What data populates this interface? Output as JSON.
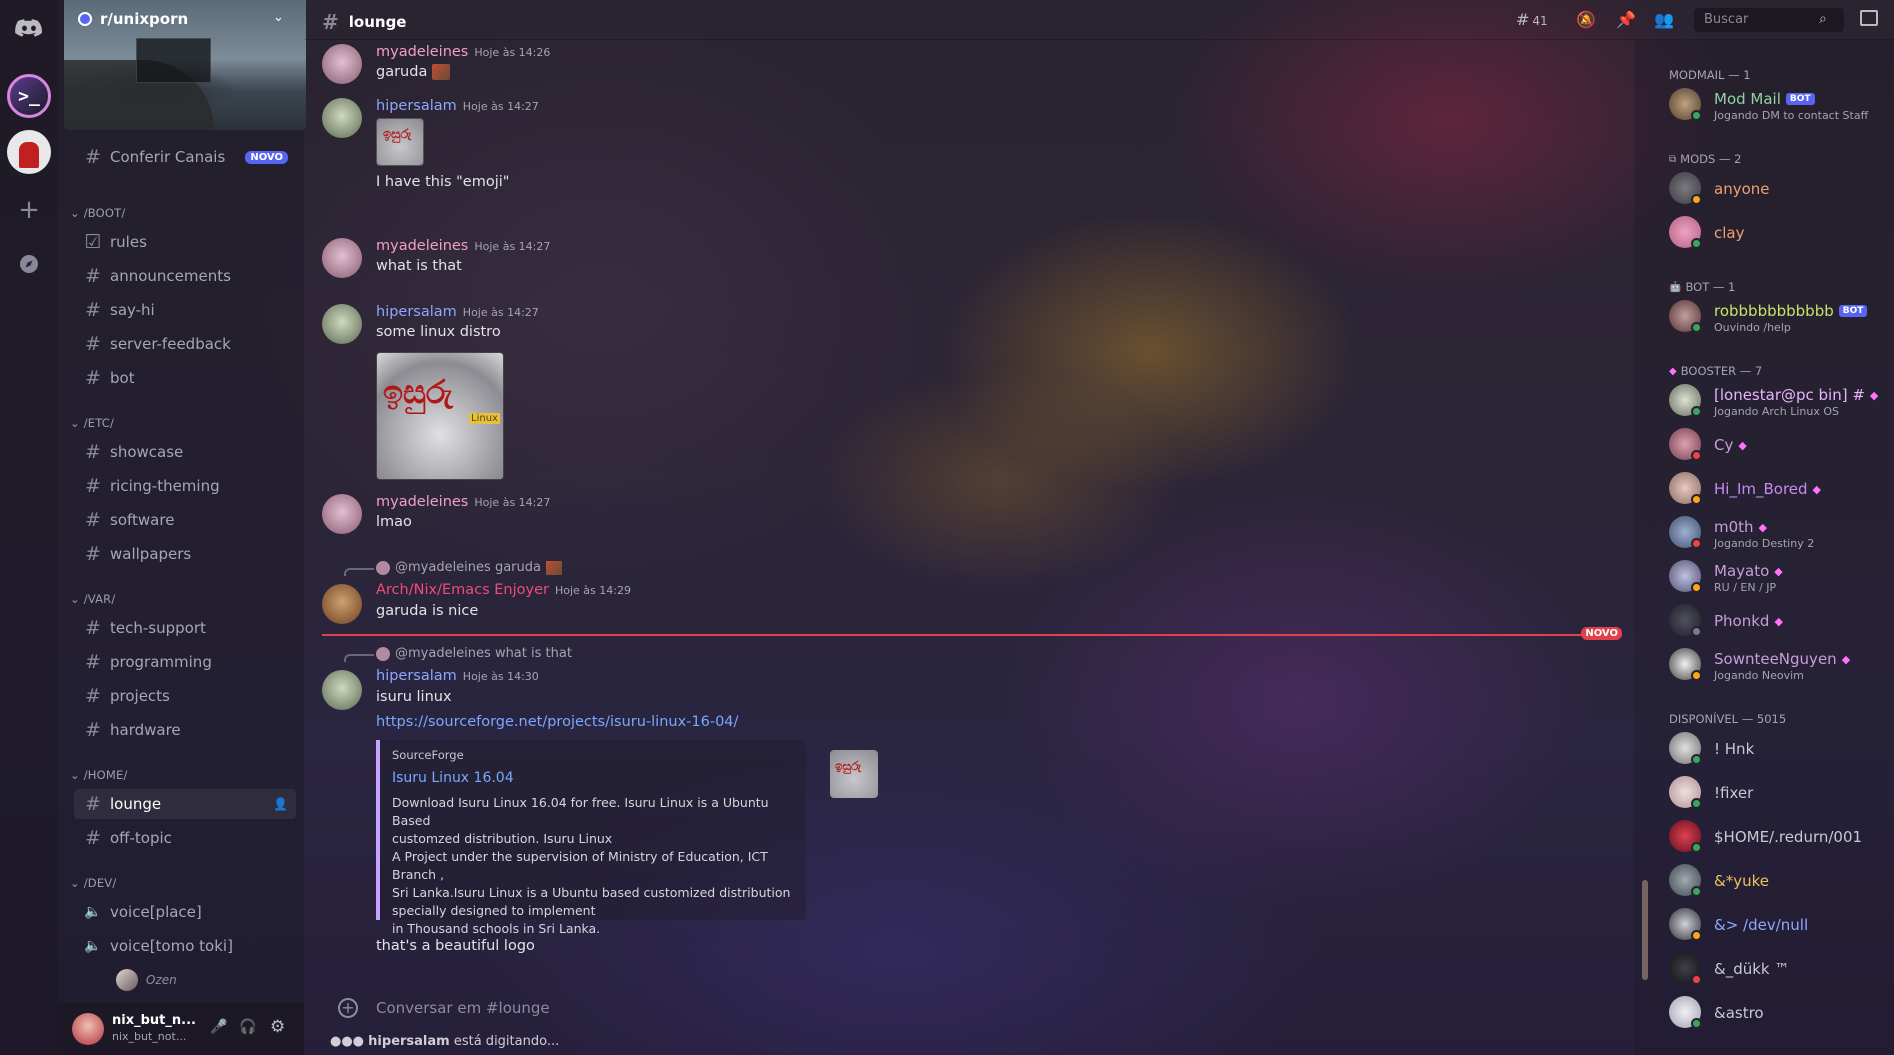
{
  "server": {
    "name": "r/unixporn",
    "browse_label": "Conferir Canais",
    "browse_badge": "NOVO"
  },
  "categories": {
    "boot": "/BOOT/",
    "etc": "/ETC/",
    "var": "/VAR/",
    "home": "/HOME/",
    "dev": "/DEV/"
  },
  "channels": {
    "rules": "rules",
    "announcements": "announcements",
    "say_hi": "say-hi",
    "server_feedback": "server-feedback",
    "bot": "bot",
    "showcase": "showcase",
    "ricing_theming": "ricing-theming",
    "software": "software",
    "wallpapers": "wallpapers",
    "tech_support": "tech-support",
    "programming": "programming",
    "projects": "projects",
    "hardware": "hardware",
    "lounge": "lounge",
    "off_topic": "off-topic",
    "voice_place": "voice[place]",
    "voice_tomo": "voice[tomo toki]",
    "voice_user": "Ozen"
  },
  "user": {
    "name": "nix_but_n...",
    "tag": "nix_but_not..."
  },
  "topbar": {
    "channel": "lounge",
    "threads_count": "41",
    "search_placeholder": "Buscar"
  },
  "messages": [
    {
      "author": "myadeleines",
      "time": "Hoje às 14:26",
      "text": "garuda"
    },
    {
      "author": "hipersalam",
      "time": "Hoje às 14:27",
      "text": "I have this \"emoji\""
    },
    {
      "author": "myadeleines",
      "time": "Hoje às 14:27",
      "text": "what is that"
    },
    {
      "author": "hipersalam",
      "time": "Hoje às 14:27",
      "text": "some linux distro"
    },
    {
      "author": "myadeleines",
      "time": "Hoje às 14:27",
      "text": "lmao"
    },
    {
      "reply": "@myadeleines garuda",
      "author": "Arch/Nix/Emacs Enjoyer",
      "time": "Hoje às 14:29",
      "text": "garuda is nice"
    },
    {
      "reply": "@myadeleines what is that",
      "author": "hipersalam",
      "time": "Hoje às 14:30",
      "text": "isuru linux",
      "link": "https://sourceforge.net/projects/isuru-linux-16-04/",
      "followup": "that's a beautiful logo"
    }
  ],
  "embed": {
    "provider": "SourceForge",
    "title": "Isuru Linux 16.04",
    "desc": [
      "Download Isuru Linux 16.04 for free. Isuru Linux is a Ubuntu Based",
      "customzed distribution. Isuru Linux",
      "A Project under the supervision of Ministry of Education, ICT Branch ,",
      "Sri Lanka.Isuru Linux is a Ubuntu based customized distribution",
      "specially designed to implement",
      "in Thousand schools in Sri Lanka."
    ]
  },
  "new_marker": "NOVO",
  "composer": {
    "placeholder": "Conversar em #lounge"
  },
  "typing": {
    "user": "hipersalam",
    "text": "está digitando..."
  },
  "member_groups": {
    "modmail": "MODMAIL — 1",
    "mods": "MODS — 2",
    "bot": "BOT — 1",
    "booster": "BOOSTER — 7",
    "online": "DISPONÍVEL — 5015"
  },
  "members": [
    {
      "name": "Mod Mail",
      "status": "Jogando DM to contact Staff",
      "badge": "BOT",
      "color": "#8fd3a0"
    },
    {
      "name": "anyone",
      "color": "#f0a070"
    },
    {
      "name": "clay",
      "color": "#f0a070"
    },
    {
      "name": "robbbbbbbbbbb",
      "status": "Ouvindo /help",
      "badge": "BOT",
      "color": "#c8e36a"
    },
    {
      "name": "[lonestar@pc bin] #",
      "status": "Jogando Arch Linux OS",
      "color": "#e8b4ff"
    },
    {
      "name": "Cy",
      "color": "#c99dd8"
    },
    {
      "name": "Hi_Im_Bored",
      "color": "#c58cf0"
    },
    {
      "name": "m0th",
      "status": "Jogando Destiny 2",
      "color": "#c99dd8"
    },
    {
      "name": "Mayato",
      "status": "RU / EN / JP",
      "color": "#c99dd8"
    },
    {
      "name": "Phonkd",
      "color": "#c99dd8"
    },
    {
      "name": "SownteeNguyen",
      "status": "Jogando Neovim",
      "color": "#c99dd8"
    },
    {
      "name": "! Hnk",
      "color": "#c9c7d2"
    },
    {
      "name": "!fixer",
      "color": "#c9c7d2"
    },
    {
      "name": "$HOME/.redurn/001",
      "color": "#c9c7d2"
    },
    {
      "name": "&*yuke",
      "color": "#f0c060"
    },
    {
      "name": "&> /dev/null",
      "color": "#8fa8ff"
    },
    {
      "name": "&_dükk ™",
      "color": "#c9c7d2"
    },
    {
      "name": "&astro",
      "color": "#c9c7d2"
    }
  ]
}
